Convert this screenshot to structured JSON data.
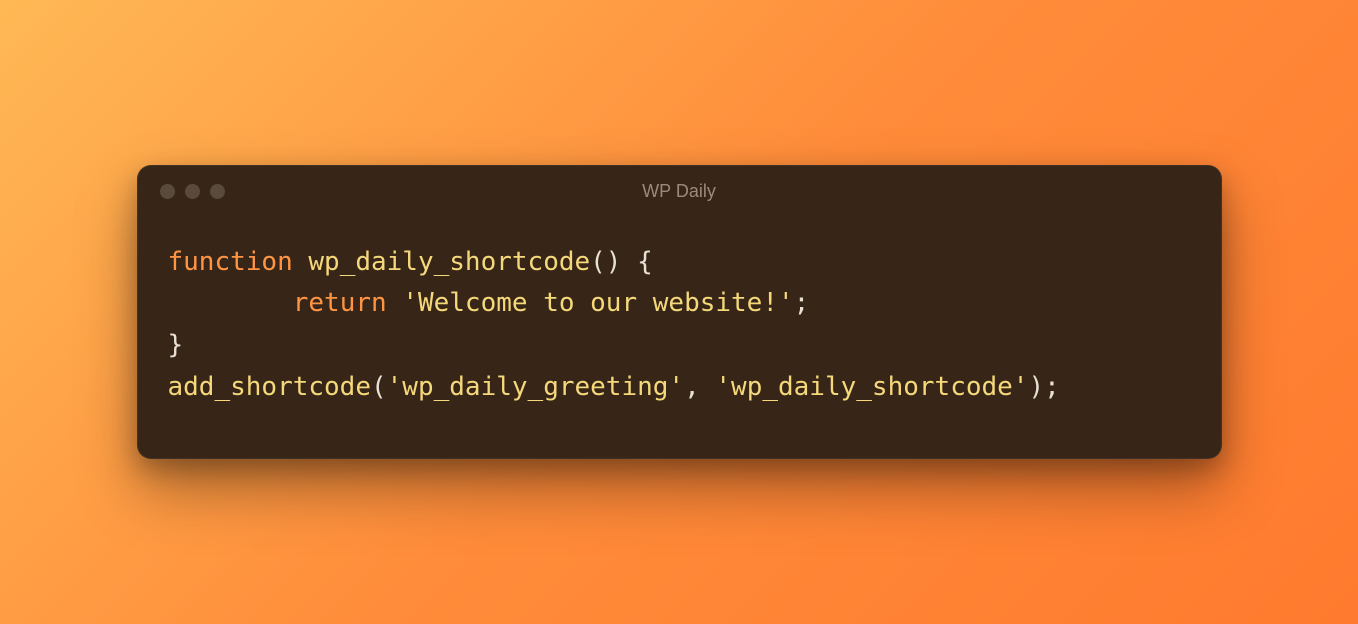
{
  "window": {
    "title": "WP Daily"
  },
  "code": {
    "line1": {
      "keyword": "function",
      "name": "wp_daily_shortcode",
      "parens": "()",
      "brace": " {"
    },
    "line2": {
      "indent": "        ",
      "keyword": "return",
      "space": " ",
      "string": "'Welcome to our website!'",
      "semi": ";"
    },
    "line3": {
      "brace": "}"
    },
    "line4": {
      "func": "add_shortcode",
      "open": "(",
      "arg1": "'wp_daily_greeting'",
      "comma": ", ",
      "arg2": "'wp_daily_shortcode'",
      "close": ");"
    }
  }
}
